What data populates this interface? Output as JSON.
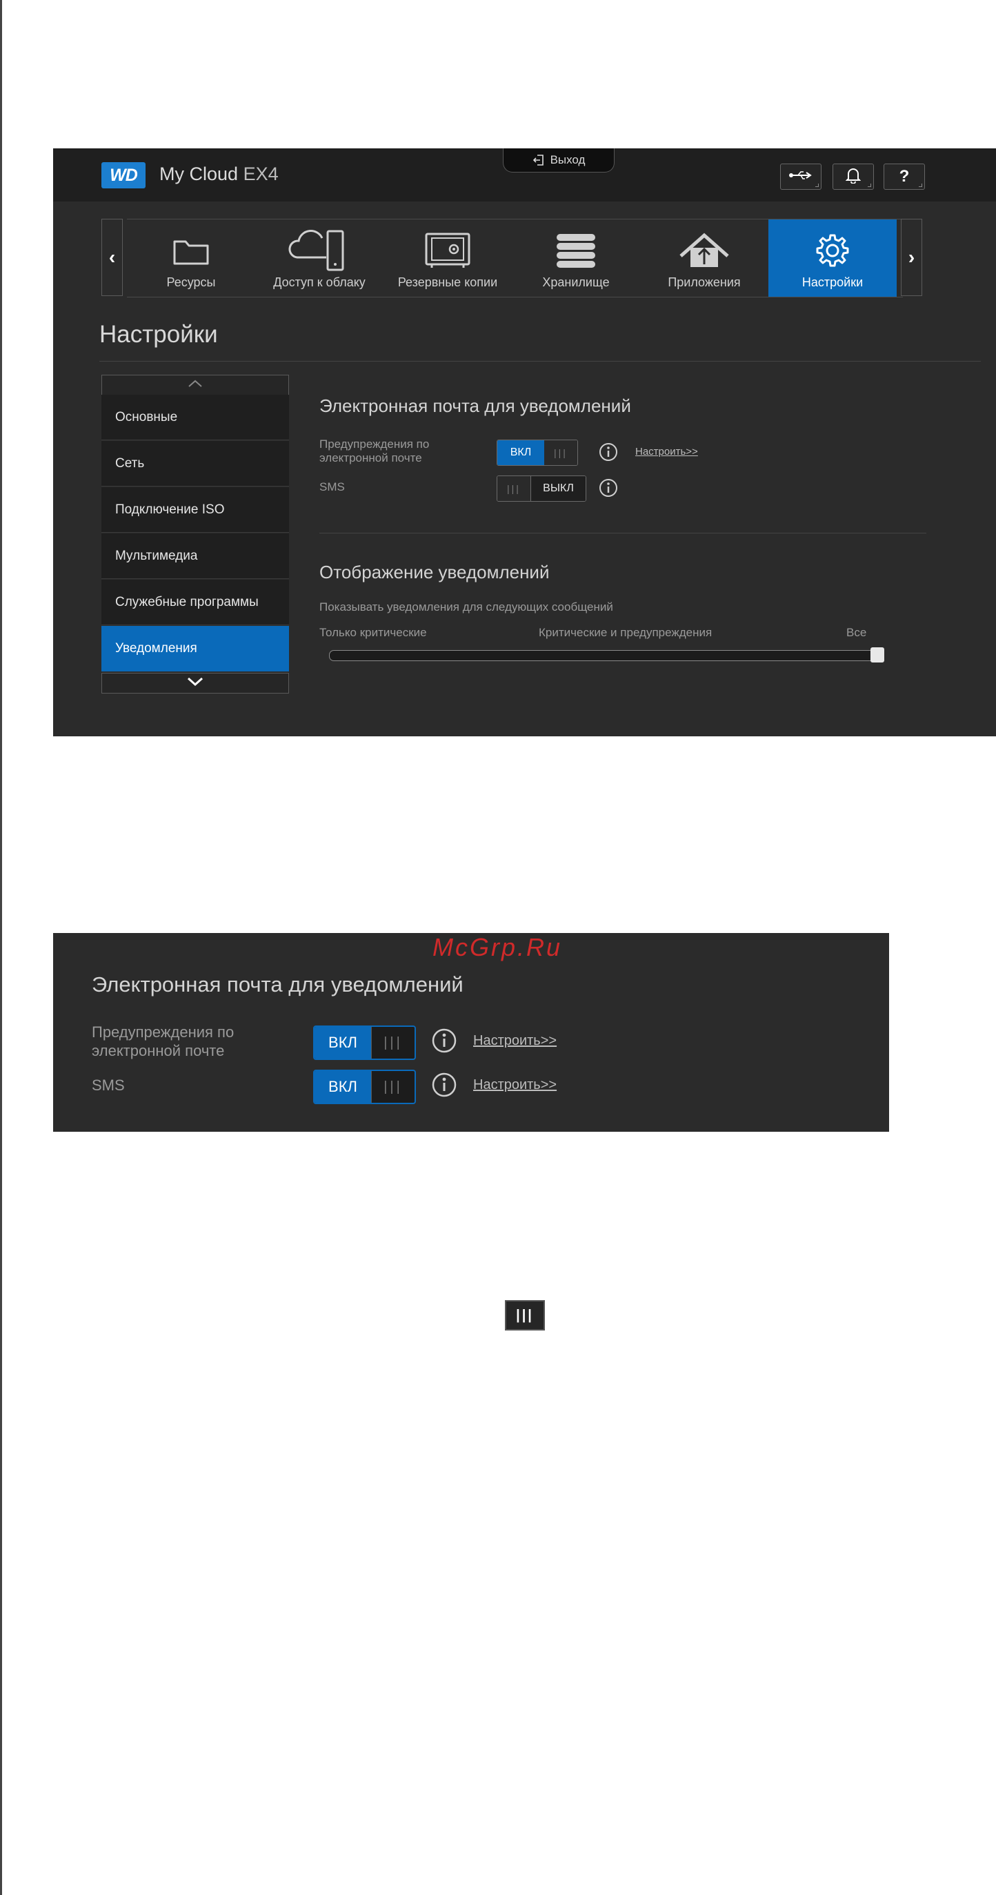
{
  "app": {
    "logo": "WD",
    "brand": "My Cloud",
    "model": "EX4",
    "logout_label": "Выход",
    "topbar_icons": [
      "usb-icon",
      "bell-icon",
      "help-icon"
    ],
    "help_label": "?"
  },
  "nav": {
    "prev_arrow": "‹",
    "next_arrow": "›",
    "items": [
      {
        "label": "Ресурсы",
        "icon": "folder-icon"
      },
      {
        "label": "Доступ к облаку",
        "icon": "cloud-device-icon"
      },
      {
        "label": "Резервные копии",
        "icon": "safe-icon"
      },
      {
        "label": "Хранилище",
        "icon": "database-icon"
      },
      {
        "label": "Приложения",
        "icon": "apps-upload-icon"
      },
      {
        "label": "Настройки",
        "icon": "gear-icon",
        "active": true
      }
    ]
  },
  "page_title": "Настройки",
  "sidebar": {
    "items": [
      {
        "label": "Основные"
      },
      {
        "label": "Сеть"
      },
      {
        "label": "Подключение ISO"
      },
      {
        "label": "Мультимедиа"
      },
      {
        "label": "Служебные программы"
      },
      {
        "label": "Уведомления",
        "active": true
      }
    ]
  },
  "email_section": {
    "title": "Электронная почта для уведомлений",
    "rows": [
      {
        "label_line1": "Предупреждения по",
        "label_line2": "электронной почте",
        "state_label": "ВКЛ",
        "state": "on",
        "configure_link": "Настроить>>"
      },
      {
        "label_line1": "SMS",
        "label_line2": "",
        "state_label": "ВЫКЛ",
        "state": "off"
      }
    ],
    "grip": "|||"
  },
  "display_section": {
    "title": "Отображение уведомлений",
    "description": "Показывать уведомления для следующих сообщений",
    "slider_labels": [
      "Только критические",
      "Критические и предупреждения",
      "Все"
    ],
    "slider_level": 1.0
  },
  "zoom": {
    "watermark": "McGrp.Ru",
    "title": "Электронная почта для уведомлений",
    "rows": [
      {
        "label_line1": "Предупреждения по",
        "label_line2": "электронной почте",
        "state_label": "ВКЛ",
        "configure_link": "Настроить>>"
      },
      {
        "label_line1": "SMS",
        "label_line2": "",
        "state_label": "ВКЛ",
        "configure_link": "Настроить>>"
      }
    ],
    "grip": "|||"
  },
  "grip_icon": "|||",
  "colors": {
    "accent": "#0a6aba",
    "background": "#2b2b2b",
    "topbar": "#1f1f1f",
    "watermark": "#d02a2a"
  }
}
